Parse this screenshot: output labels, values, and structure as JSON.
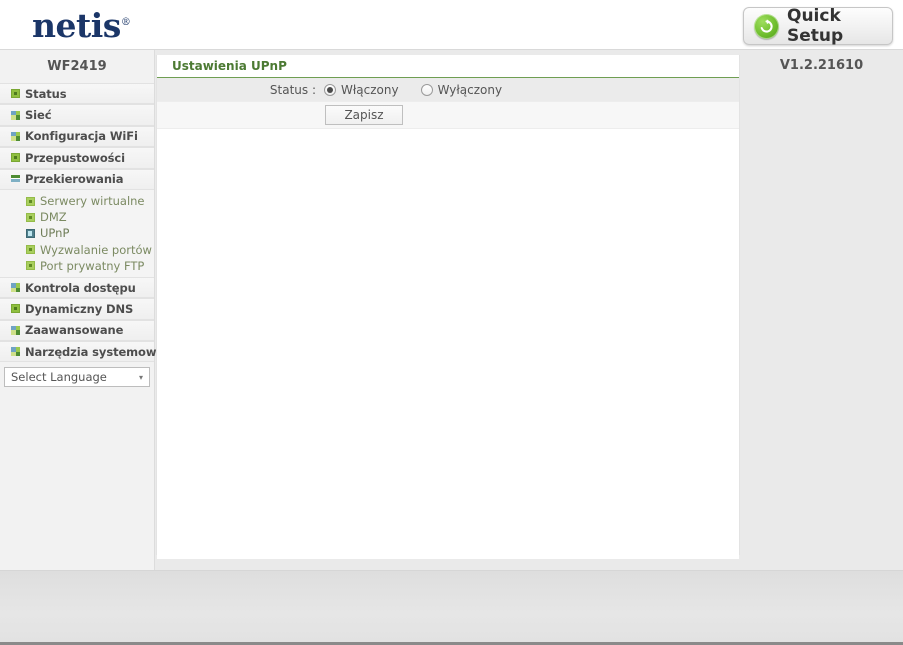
{
  "header": {
    "logo_text": "netis",
    "logo_registered": "®",
    "quick_setup_label": "Quick Setup",
    "quick_setup_icon": "refresh-circle-icon"
  },
  "sidebar": {
    "model": "WF2419",
    "items": [
      {
        "label": "Status",
        "icon": "green-tile-icon"
      },
      {
        "label": "Sieć",
        "icon": "multi-tile-icon"
      },
      {
        "label": "Konfiguracja WiFi",
        "icon": "multi-tile-icon"
      },
      {
        "label": "Przepustowości",
        "icon": "green-tile-icon"
      },
      {
        "label": "Przekierowania",
        "icon": "bars-tile-icon"
      },
      {
        "label": "Kontrola dostępu",
        "icon": "multi-tile-icon"
      },
      {
        "label": "Dynamiczny DNS",
        "icon": "green-tile-icon"
      },
      {
        "label": "Zaawansowane",
        "icon": "multi-tile-icon"
      },
      {
        "label": "Narzędzia systemowe",
        "icon": "multi-tile-icon"
      }
    ],
    "subitems": [
      {
        "label": "Serwery wirtualne",
        "icon": "green-square-icon",
        "active": false
      },
      {
        "label": "DMZ",
        "icon": "green-square-icon",
        "active": false
      },
      {
        "label": "UPnP",
        "icon": "blue-square-icon",
        "active": true
      },
      {
        "label": "Wyzwalanie portów",
        "icon": "green-square-icon",
        "active": false
      },
      {
        "label": "Port prywatny FTP",
        "icon": "green-square-icon",
        "active": false
      }
    ],
    "language_selected": "Select Language",
    "language_caret": "▾"
  },
  "content": {
    "panel_title": "Ustawienia UPnP",
    "status_label": "Status :",
    "radios": [
      {
        "label": "Włączony",
        "checked": true
      },
      {
        "label": "Wyłączony",
        "checked": false
      }
    ],
    "save_label": "Zapisz"
  },
  "right": {
    "version": "V1.2.21610"
  },
  "colors": {
    "brand_navy": "#1b3668",
    "accent_green": "#4c7a33",
    "tile_green": "#8fbf3f",
    "active_blue": "#4f7f8c",
    "page_bg": "#eaeaea"
  }
}
